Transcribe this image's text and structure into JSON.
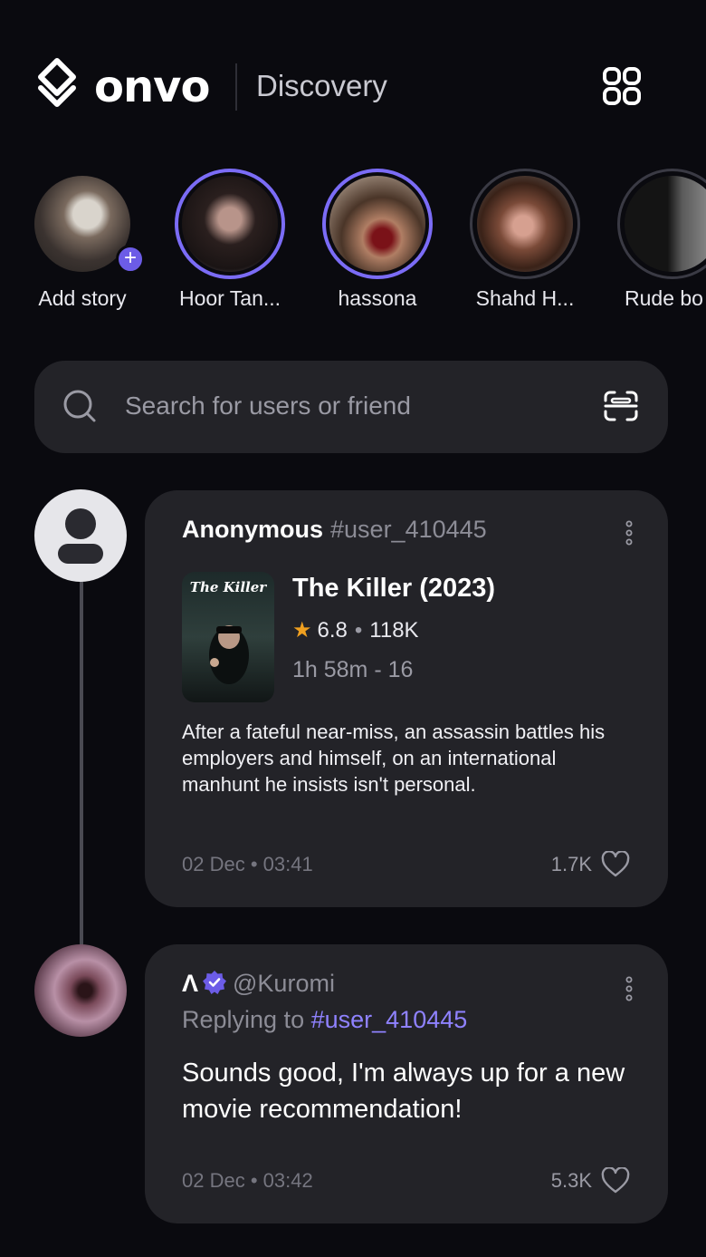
{
  "header": {
    "brand": "onvo",
    "section": "Discovery"
  },
  "stories": [
    {
      "name": "Add story",
      "active": false,
      "add": true
    },
    {
      "name": "Hoor Tan...",
      "active": true
    },
    {
      "name": "hassona",
      "active": true
    },
    {
      "name": "Shahd H...",
      "active": false
    },
    {
      "name": "Rude bo",
      "active": false
    }
  ],
  "search": {
    "placeholder": "Search for users or friend"
  },
  "posts": [
    {
      "author": "Anonymous",
      "handle": "#user_410445",
      "movie": {
        "title": "The Killer (2023)",
        "rating": "6.8",
        "votes": "118K",
        "runtime": "1h 58m - 16",
        "poster_title": "The Killer"
      },
      "text": "After a fateful near-miss, an assassin battles his employers and himself, on an international manhunt he insists isn't personal.",
      "timestamp": "02 Dec • 03:41",
      "likes": "1.7K"
    },
    {
      "author": "Λ",
      "handle": "@Kuromi",
      "verified": true,
      "reply_prefix": "Replying to",
      "reply_tag": "#user_410445",
      "text": "Sounds good, I'm always up for a new movie recommendation!",
      "timestamp": "02 Dec • 03:42",
      "likes": "5.3K"
    }
  ],
  "colors": {
    "background": "#0a0a0f",
    "card": "#232328",
    "accent": "#7b6cf6",
    "star": "#f0a020"
  },
  "icons": [
    "onvo-logo-icon",
    "grid-menu-icon",
    "search-icon",
    "scan-icon",
    "more-vertical-icon",
    "heart-icon",
    "verified-icon",
    "person-icon",
    "plus-icon",
    "star-icon"
  ]
}
